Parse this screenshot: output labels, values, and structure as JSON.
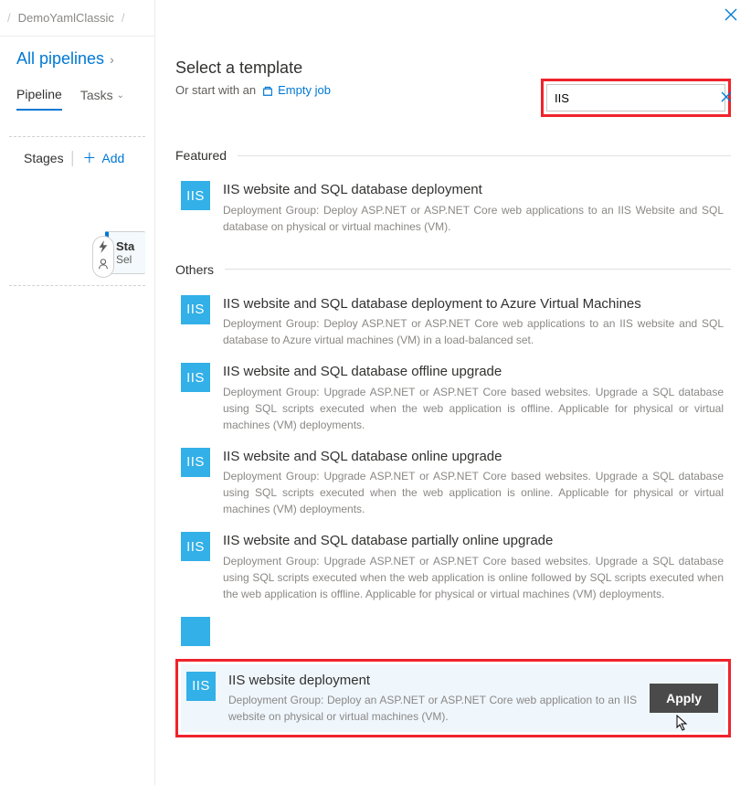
{
  "breadcrumb": {
    "slash": "/",
    "project": "DemoYamlClassic",
    "sep": "/"
  },
  "sidebar": {
    "all_pipelines": "All pipelines",
    "tabs": {
      "pipeline": "Pipeline",
      "tasks": "Tasks"
    }
  },
  "canvas": {
    "stages_label": "Stages",
    "add_label": "Add",
    "stage_card": {
      "title": "Sta",
      "subtitle": "Sel"
    }
  },
  "panel": {
    "title": "Select a template",
    "subtitle_prefix": "Or start with an",
    "empty_job": "Empty job",
    "search_value": "IIS"
  },
  "sections": {
    "featured": "Featured",
    "others": "Others"
  },
  "templates": {
    "featured": [
      {
        "logo": "IIS",
        "name": "IIS website and SQL database deployment",
        "desc": "Deployment Group: Deploy ASP.NET or ASP.NET Core web applications to an IIS Website and SQL database on physical or virtual machines (VM)."
      }
    ],
    "others": [
      {
        "logo": "IIS",
        "name": "IIS website and SQL database deployment to Azure Virtual Machines",
        "desc": "Deployment Group: Deploy ASP.NET or ASP.NET Core web applications to an IIS website and SQL database to Azure virtual machines (VM) in a load-balanced set."
      },
      {
        "logo": "IIS",
        "name": "IIS website and SQL database offline upgrade",
        "desc": "Deployment Group: Upgrade ASP.NET or ASP.NET Core based websites. Upgrade a SQL database using SQL scripts executed when the web application is offline. Applicable for physical or virtual machines (VM) deployments."
      },
      {
        "logo": "IIS",
        "name": "IIS website and SQL database online upgrade",
        "desc": "Deployment Group: Upgrade ASP.NET or ASP.NET Core based websites. Upgrade a SQL database using SQL scripts executed when the web application is online. Applicable for physical or virtual machines (VM) deployments."
      },
      {
        "logo": "IIS",
        "name": "IIS website and SQL database partially online upgrade",
        "desc": "Deployment Group: Upgrade ASP.NET or ASP.NET Core based websites. Upgrade a SQL database using SQL scripts executed when the web application is online followed by SQL scripts executed when the web application is offline. Applicable for physical or virtual machines (VM) deployments."
      }
    ],
    "selected": {
      "logo": "IIS",
      "name": "IIS website deployment",
      "desc": "Deployment Group: Deploy an ASP.NET or ASP.NET Core web application to an IIS website on physical or virtual machines (VM).",
      "apply": "Apply"
    }
  }
}
